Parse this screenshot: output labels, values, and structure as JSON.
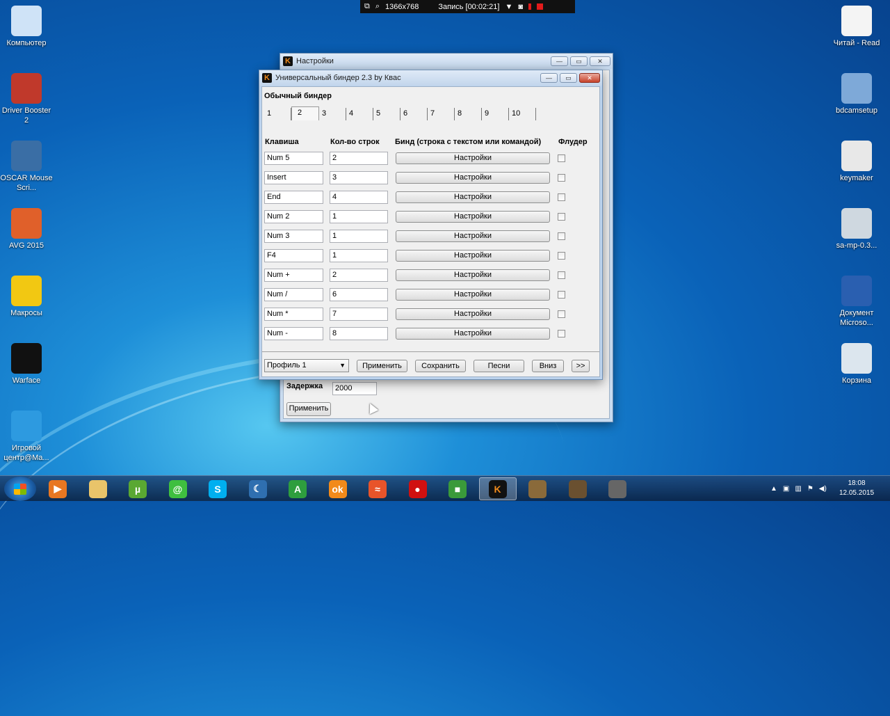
{
  "recorder": {
    "resolution": "1366x768",
    "status": "Запись [00:02:21]"
  },
  "desktop_icons_left": [
    {
      "label": "Компьютер",
      "icon": "computer-icon",
      "color": "#cfe3f7"
    },
    {
      "label": "Driver Booster 2",
      "icon": "driver-booster-icon",
      "color": "#c0392b"
    },
    {
      "label": "OSCAR Mouse Scri...",
      "icon": "oscar-icon",
      "color": "#3a6ea5"
    },
    {
      "label": "AVG 2015",
      "icon": "avg-icon",
      "color": "#e0602a"
    },
    {
      "label": "Макросы",
      "icon": "warning-icon",
      "color": "#f2c812"
    },
    {
      "label": "Warface",
      "icon": "warface-icon",
      "color": "#111111"
    },
    {
      "label": "Игровой центр@Ma...",
      "icon": "game-center-icon",
      "color": "#2d9ae0"
    }
  ],
  "desktop_icons_right": [
    {
      "label": "Читай - Read",
      "icon": "document-icon",
      "color": "#f4f4f4"
    },
    {
      "label": "bdcamsetup",
      "icon": "setup-icon",
      "color": "#7ea9d8"
    },
    {
      "label": "keymaker",
      "icon": "hat-icon",
      "color": "#e8e8e8"
    },
    {
      "label": "sa-mp-0.3...",
      "icon": "disc-icon",
      "color": "#cfd8e0"
    },
    {
      "label": "Документ Microso...",
      "icon": "word-icon",
      "color": "#2a5fb0"
    },
    {
      "label": "Корзина",
      "icon": "recycle-bin-icon",
      "color": "#dce6ee"
    }
  ],
  "settings_window": {
    "title": "Настройки",
    "delay_label": "Задержка",
    "delay_value": "2000",
    "apply_label": "Применить"
  },
  "binder_window": {
    "title": "Универсальный биндер 2.3 by Квас",
    "section_title": "Обычный биндер",
    "tabs": [
      "1",
      "2",
      "3",
      "4",
      "5",
      "6",
      "7",
      "8",
      "9",
      "10"
    ],
    "active_tab": "2",
    "headers": {
      "key": "Клавиша",
      "count": "Кол-во строк",
      "bind": "Бинд (строка с текстом или командой)",
      "flood": "Флудер"
    },
    "rows": [
      {
        "key": "Num 5",
        "count": "2",
        "btn": "Настройки",
        "flood": false
      },
      {
        "key": "Insert",
        "count": "3",
        "btn": "Настройки",
        "flood": false
      },
      {
        "key": "End",
        "count": "4",
        "btn": "Настройки",
        "flood": false
      },
      {
        "key": "Num 2",
        "count": "1",
        "btn": "Настройки",
        "flood": false
      },
      {
        "key": "Num 3",
        "count": "1",
        "btn": "Настройки",
        "flood": false
      },
      {
        "key": "F4",
        "count": "1",
        "btn": "Настройки",
        "flood": false
      },
      {
        "key": "Num +",
        "count": "2",
        "btn": "Настройки",
        "flood": false
      },
      {
        "key": "Num /",
        "count": "6",
        "btn": "Настройки",
        "flood": false
      },
      {
        "key": "Num *",
        "count": "7",
        "btn": "Настройки",
        "flood": false
      },
      {
        "key": "Num -",
        "count": "8",
        "btn": "Настройки",
        "flood": false
      }
    ],
    "footer": {
      "profile": "Профиль 1",
      "apply": "Применить",
      "save": "Сохранить",
      "songs": "Песни",
      "down": "Вниз",
      "next": ">>"
    }
  },
  "taskbar": {
    "items": [
      {
        "icon": "media-player-icon",
        "color": "#e87722",
        "glyph": "▶"
      },
      {
        "icon": "folder-icon",
        "color": "#e9c46a",
        "glyph": ""
      },
      {
        "icon": "utorrent-icon",
        "color": "#5aa832",
        "glyph": "µ"
      },
      {
        "icon": "mail-agent-icon",
        "color": "#3fbf3f",
        "glyph": "@"
      },
      {
        "icon": "skype-icon",
        "color": "#00aff0",
        "glyph": "S"
      },
      {
        "icon": "moon-app-icon",
        "color": "#2f6fb0",
        "glyph": "☾"
      },
      {
        "icon": "green-a-icon",
        "color": "#2e9e3e",
        "glyph": "A"
      },
      {
        "icon": "odnoklassniki-icon",
        "color": "#f28a1a",
        "glyph": "ok"
      },
      {
        "icon": "fish-icon",
        "color": "#e8542a",
        "glyph": "≈"
      },
      {
        "icon": "record-icon",
        "color": "#d01010",
        "glyph": "●"
      },
      {
        "icon": "green-square-icon",
        "color": "#3a9a3a",
        "glyph": "■"
      },
      {
        "icon": "binder-k-icon",
        "color": "#111111",
        "glyph": "K"
      },
      {
        "icon": "game-character-icon",
        "color": "#8a6a3a",
        "glyph": ""
      },
      {
        "icon": "game-character2-icon",
        "color": "#6a5030",
        "glyph": ""
      },
      {
        "icon": "truck-icon",
        "color": "#666666",
        "glyph": ""
      }
    ],
    "time": "18:08",
    "date": "12.05.2015"
  }
}
